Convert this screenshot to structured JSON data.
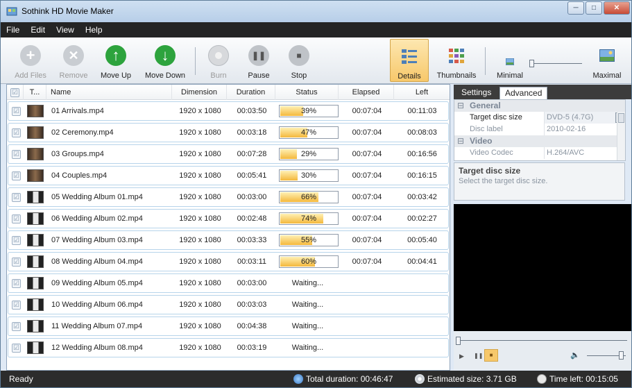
{
  "window": {
    "title": "Sothink HD Movie Maker",
    "minimize": "─",
    "maximize": "□",
    "close": "✕"
  },
  "menu": [
    "File",
    "Edit",
    "View",
    "Help"
  ],
  "toolbar": {
    "add_files": "Add Files",
    "remove": "Remove",
    "move_up": "Move Up",
    "move_down": "Move Down",
    "burn": "Burn",
    "pause": "Pause",
    "stop": "Stop",
    "details": "Details",
    "thumbnails": "Thumbnails",
    "minimal": "Minimal",
    "maximal": "Maximal",
    "zoom_level": 0.0
  },
  "columns": {
    "check": "☑",
    "thumb": "T...",
    "name": "Name",
    "dimension": "Dimension",
    "duration": "Duration",
    "status": "Status",
    "elapsed": "Elapsed",
    "left": "Left"
  },
  "rows": [
    {
      "check": "☑",
      "name": "01 Arrivals.mp4",
      "dimension": "1920 x 1080",
      "duration": "00:03:50",
      "status": "39%",
      "progress": 39,
      "elapsed": "00:07:04",
      "left": "00:11:03",
      "thumb": "film"
    },
    {
      "check": "☑",
      "name": "02 Ceremony.mp4",
      "dimension": "1920 x 1080",
      "duration": "00:03:18",
      "status": "47%",
      "progress": 47,
      "elapsed": "00:07:04",
      "left": "00:08:03",
      "thumb": "film"
    },
    {
      "check": "☑",
      "name": "03 Groups.mp4",
      "dimension": "1920 x 1080",
      "duration": "00:07:28",
      "status": "29%",
      "progress": 29,
      "elapsed": "00:07:04",
      "left": "00:16:56",
      "thumb": "film"
    },
    {
      "check": "☑",
      "name": "04 Couples.mp4",
      "dimension": "1920 x 1080",
      "duration": "00:05:41",
      "status": "30%",
      "progress": 30,
      "elapsed": "00:07:04",
      "left": "00:16:15",
      "thumb": "film"
    },
    {
      "check": "☑",
      "name": "05 Wedding Album 01.mp4",
      "dimension": "1920 x 1080",
      "duration": "00:03:00",
      "status": "66%",
      "progress": 66,
      "elapsed": "00:07:04",
      "left": "00:03:42",
      "thumb": "album"
    },
    {
      "check": "☑",
      "name": "06 Wedding Album 02.mp4",
      "dimension": "1920 x 1080",
      "duration": "00:02:48",
      "status": "74%",
      "progress": 74,
      "elapsed": "00:07:04",
      "left": "00:02:27",
      "thumb": "album"
    },
    {
      "check": "☑",
      "name": "07 Wedding Album 03.mp4",
      "dimension": "1920 x 1080",
      "duration": "00:03:33",
      "status": "55%",
      "progress": 55,
      "elapsed": "00:07:04",
      "left": "00:05:40",
      "thumb": "album"
    },
    {
      "check": "☑",
      "name": "08 Wedding Album 04.mp4",
      "dimension": "1920 x 1080",
      "duration": "00:03:11",
      "status": "60%",
      "progress": 60,
      "elapsed": "00:07:04",
      "left": "00:04:41",
      "thumb": "album"
    },
    {
      "check": "☑",
      "name": "09 Wedding Album 05.mp4",
      "dimension": "1920 x 1080",
      "duration": "00:03:00",
      "status": "Waiting...",
      "progress": null,
      "elapsed": "",
      "left": "",
      "thumb": "album"
    },
    {
      "check": "☑",
      "name": "10 Wedding Album 06.mp4",
      "dimension": "1920 x 1080",
      "duration": "00:03:03",
      "status": "Waiting...",
      "progress": null,
      "elapsed": "",
      "left": "",
      "thumb": "album"
    },
    {
      "check": "☑",
      "name": "11 Wedding Album 07.mp4",
      "dimension": "1920 x 1080",
      "duration": "00:04:38",
      "status": "Waiting...",
      "progress": null,
      "elapsed": "",
      "left": "",
      "thumb": "album"
    },
    {
      "check": "☑",
      "name": "12 Wedding Album 08.mp4",
      "dimension": "1920 x 1080",
      "duration": "00:03:19",
      "status": "Waiting...",
      "progress": null,
      "elapsed": "",
      "left": "",
      "thumb": "album"
    }
  ],
  "panel": {
    "tabs": [
      "Settings",
      "Advanced"
    ],
    "active_tab": "Advanced",
    "groups": {
      "general": "General",
      "video": "Video"
    },
    "props": {
      "target_disc_size": {
        "key": "Target disc size",
        "value": "DVD-5 (4.7G)"
      },
      "disc_label": {
        "key": "Disc label",
        "value": "2010-02-16"
      },
      "video_codec": {
        "key": "Video Codec",
        "value": "H.264/AVC"
      }
    },
    "collapse": "⊟",
    "dropdown": "▾",
    "description_title": "Target disc size",
    "description_text": "Select the target disc size."
  },
  "player": {
    "play": "▶",
    "pause": "❚❚",
    "stop": "■",
    "volume": "🔈"
  },
  "status": {
    "ready": "Ready",
    "total_duration": "Total duration: 00:46:47",
    "estimated_size": "Estimated size: 3.71 GB",
    "time_left": "Time left: 00:15:05"
  },
  "colors": {
    "progress_fill": "#f4b83c",
    "active_button": "#f7c86b",
    "menubar": "#242424"
  }
}
